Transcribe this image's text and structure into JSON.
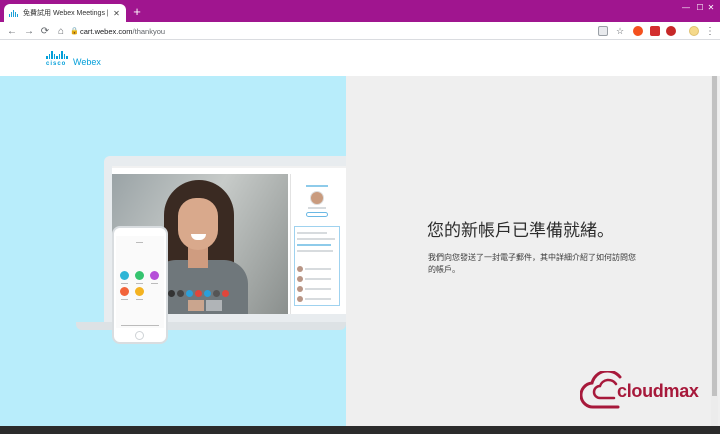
{
  "browser": {
    "tab_title": "免費試用 Webex Meetings | —下",
    "tab_close": "✕",
    "new_tab": "+",
    "window": {
      "minimize": "—",
      "maximize": "☐",
      "close": "✕"
    },
    "nav": {
      "back": "←",
      "forward": "→",
      "reload": "⟳",
      "home": "⌂"
    },
    "url_host": "cart.webex.com",
    "url_path": "/thankyou",
    "menu": "⋮",
    "accent": "#a0158f"
  },
  "site": {
    "logo_word": "cisco",
    "product": "Webex"
  },
  "main": {
    "headline": "您的新帳戶已準備就緒。",
    "message": "我們向您發送了一封電子郵件，其中詳細介紹了如何訪問您的帳戶。"
  },
  "watermark": {
    "text": "cloudmax",
    "color": "#a7193b"
  }
}
